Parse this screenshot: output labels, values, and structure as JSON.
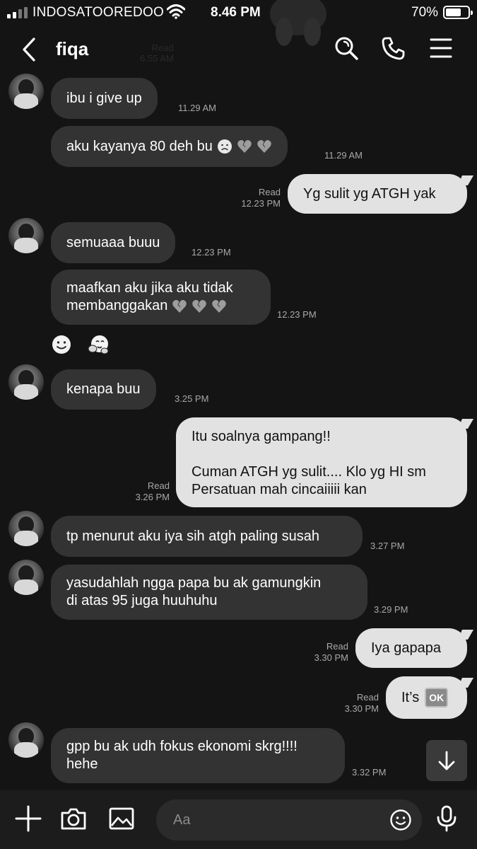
{
  "status_bar": {
    "carrier": "INDOSATOOREDOO",
    "time": "8.46 PM",
    "battery_pct": "70%",
    "battery_level": 0.7
  },
  "header": {
    "contact_name": "fiqa",
    "ghost_read": "Read",
    "ghost_time": "6.55 AM",
    "icons": [
      "back-icon",
      "search-icon",
      "phone-icon",
      "menu-icon"
    ]
  },
  "messages": [
    {
      "dir": "in",
      "text": "ibu i give up",
      "time": "11.29 AM"
    },
    {
      "dir": "in",
      "text": "aku kayanya 80 deh bu",
      "emojis": [
        "frown-face",
        "broken-heart",
        "broken-heart"
      ],
      "time": "11.29 AM"
    },
    {
      "dir": "out",
      "text": "Yg sulit yg ATGH yak",
      "read": "Read",
      "time": "12.23 PM"
    },
    {
      "dir": "in",
      "text": "semuaaa buuu",
      "time": "12.23 PM"
    },
    {
      "dir": "in",
      "text": "maafkan aku jika aku tidak\nmembanggakan",
      "emojis": [
        "broken-heart",
        "broken-heart",
        "broken-heart"
      ],
      "time": "12.23 PM"
    },
    {
      "dir": "in",
      "text": "kenapa buu",
      "time": "3.25 PM"
    },
    {
      "dir": "out",
      "text": "Itu soalnya gampang!!\n\nCuman ATGH yg sulit.... Klo yg HI sm\nPersatuan mah cincaiiiii kan",
      "read": "Read",
      "time": "3.26 PM"
    },
    {
      "dir": "in",
      "text": "tp menurut aku iya sih atgh paling susah",
      "time": "3.27 PM"
    },
    {
      "dir": "in",
      "text": "yasudahlah ngga papa bu ak gamungkin\ndi atas 95 juga huuhuhu",
      "time": "3.29 PM"
    },
    {
      "dir": "out",
      "text": "Iya gapapa",
      "read": "Read",
      "time": "3.30 PM"
    },
    {
      "dir": "out",
      "text": "It’s",
      "badge": "OK",
      "read": "Read",
      "time": "3.30 PM"
    },
    {
      "dir": "in",
      "text": "gpp bu ak udh fokus ekonomi skrg!!!!\nhehe",
      "time": "3.32 PM"
    }
  ],
  "reactions": [
    "smile-reaction",
    "hug-reaction"
  ],
  "input": {
    "placeholder": "Aa",
    "value": ""
  },
  "colors": {
    "background": "#141414",
    "incoming_bubble": "#333333",
    "outgoing_bubble": "#e2e2e2",
    "meta_text": "#a8a8a8",
    "input_bar": "#1c1c1c"
  }
}
